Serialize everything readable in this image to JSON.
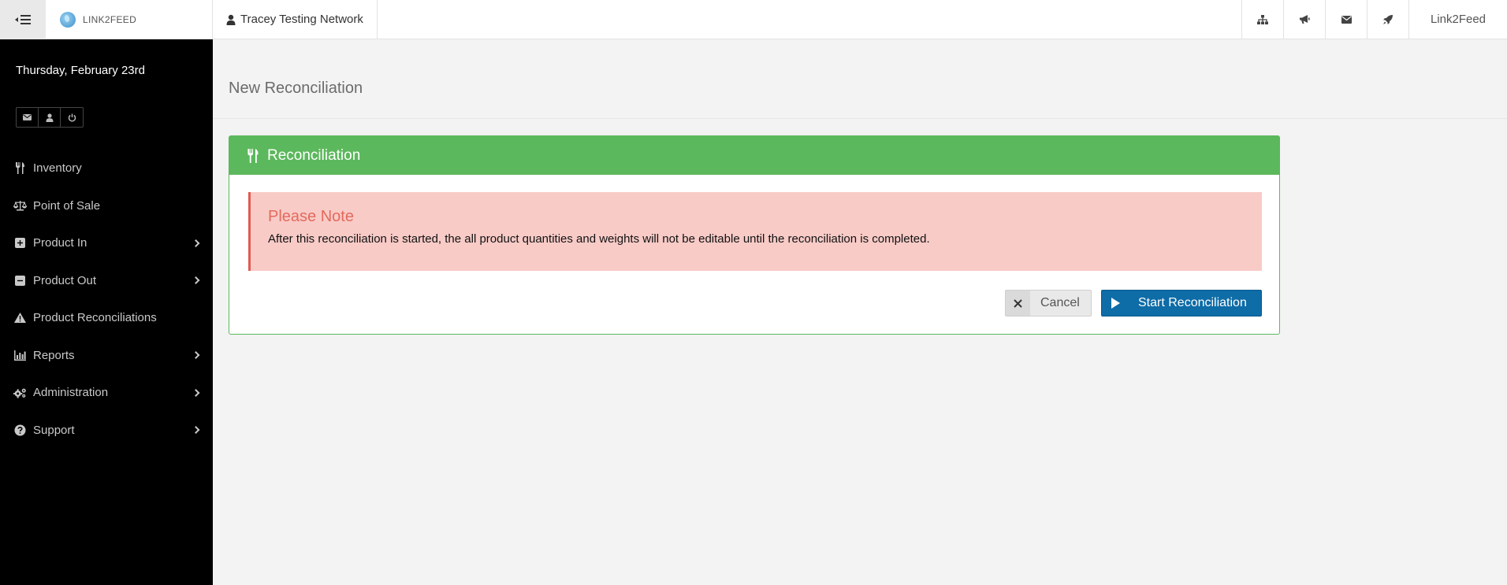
{
  "topbar": {
    "brand": "LINK2FEED",
    "network": "Tracey Testing Network",
    "icons": [
      "sitemap-icon",
      "bullhorn-icon",
      "envelope-icon",
      "rocket-icon"
    ],
    "user": "Link2Feed"
  },
  "sidebar": {
    "date": "Thursday, February 23rd",
    "quick_icons": [
      "envelope-icon",
      "user-icon",
      "power-icon"
    ],
    "items": [
      {
        "label": "Inventory",
        "icon": "utensils-icon",
        "has_submenu": false
      },
      {
        "label": "Point of Sale",
        "icon": "balance-scale-icon",
        "has_submenu": false
      },
      {
        "label": "Product In",
        "icon": "plus-square-icon",
        "has_submenu": true
      },
      {
        "label": "Product Out",
        "icon": "minus-square-icon",
        "has_submenu": true
      },
      {
        "label": "Product Reconciliations",
        "icon": "warning-icon",
        "has_submenu": false
      },
      {
        "label": "Reports",
        "icon": "bar-chart-icon",
        "has_submenu": true
      },
      {
        "label": "Administration",
        "icon": "cogs-icon",
        "has_submenu": true
      },
      {
        "label": "Support",
        "icon": "question-circle-icon",
        "has_submenu": true
      }
    ]
  },
  "page": {
    "title": "New Reconciliation"
  },
  "panel": {
    "title": "Reconciliation",
    "header_color": "#5cb85c",
    "alert": {
      "title": "Please Note",
      "text": "After this reconciliation is started, the all product quantities and weights will not be editable until the reconciliation is completed."
    },
    "cancel_label": "Cancel",
    "start_label": "Start Reconciliation",
    "start_color": "#0e6ca7"
  }
}
